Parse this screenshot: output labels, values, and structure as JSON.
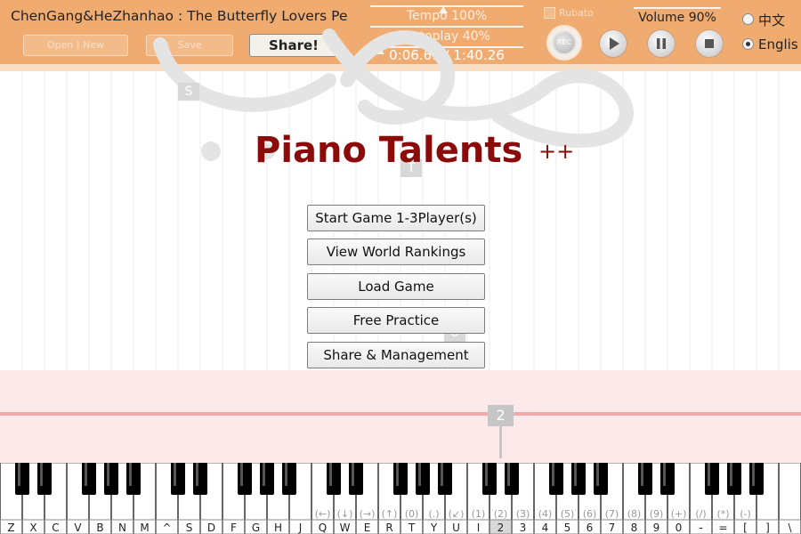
{
  "header": {
    "song_title": "ChenGang&HeZhanhao : The Butterfly Lovers  Pe",
    "open_new_label": "Open | New",
    "save_label": "Save",
    "share_label": "Share!",
    "tempo_label": "Tempo 100%",
    "tempo_value": 1.0,
    "autoplay_label": "Autoplay 40%",
    "autoplay_value": 0.4,
    "time_label": "0:06.69 / 1:40.26",
    "rubato_label": "Rubato",
    "rec_label": "REC",
    "volume_label": "Volume 90%",
    "volume_value": 0.9,
    "lang_chinese": "中文",
    "lang_english": "Englis",
    "lang_selected": "english"
  },
  "main": {
    "title": "Piano Talents",
    "title_suffix": "++",
    "hint_s": "S",
    "hint_t": "T",
    "hint_u": "U",
    "menu": [
      "Start Game 1-3Player(s)",
      "View World Rankings",
      "Load Game",
      "Free Practice",
      "Share & Management"
    ],
    "lane_marker": "2"
  },
  "keyboard": {
    "white_key_labels": [
      "Z",
      "X",
      "C",
      "V",
      "B",
      "N",
      "M",
      "^",
      "S",
      "D",
      "F",
      "G",
      "H",
      "J",
      "Q",
      "W",
      "E",
      "R",
      "T",
      "Y",
      "U",
      "I",
      "2",
      "3",
      "4",
      "5",
      "6",
      "7",
      "8",
      "9",
      "0",
      "-",
      "=",
      "[",
      "]",
      "\\"
    ],
    "alt_labels": [
      "",
      "",
      "",
      "",
      "",
      "",
      "",
      "",
      "",
      "",
      "",
      "",
      "",
      "",
      "(←)",
      "(↓)",
      "(→)",
      "(↑)",
      "(0)",
      "(.)",
      "(↙)",
      "(1)",
      "(2)",
      "(3)",
      "(4)",
      "(5)",
      "(6)",
      "(7)",
      "(8)",
      "(9)",
      "(+)",
      "(/)",
      "(*)",
      "(-)",
      "",
      ""
    ],
    "highlight_index": 22,
    "colors": {
      "white_key": "#ffffff",
      "black_key": "#000000",
      "accent": "#8b0a0a",
      "header": "#f0ac70"
    }
  }
}
